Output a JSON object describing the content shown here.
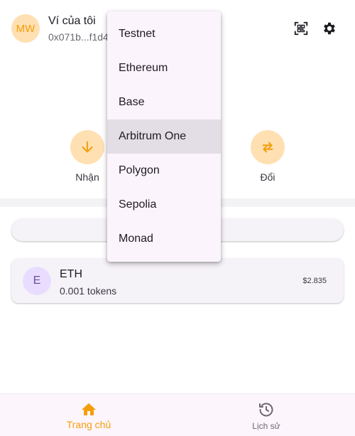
{
  "header": {
    "avatar_initials": "MW",
    "wallet_name": "Ví của tôi",
    "wallet_address": "0x071b...f1d4",
    "qr_icon": "qr-scan-icon",
    "settings_icon": "gear-icon"
  },
  "actions": {
    "receive_label": "Nhận",
    "swap_label": "Đổi",
    "receive_icon": "arrow-down-icon",
    "swap_icon": "swap-icon"
  },
  "tokens": [
    {
      "avatar": "E",
      "symbol": "ETH",
      "amount": "0.001 tokens",
      "value": "$2.835"
    }
  ],
  "network_menu": {
    "items": [
      "Testnet",
      "Ethereum",
      "Base",
      "Arbitrum One",
      "Polygon",
      "Sepolia",
      "Monad"
    ],
    "selected": "Arbitrum One"
  },
  "bottom_nav": {
    "items": [
      {
        "label": "Trang chủ",
        "icon": "home-icon",
        "active": true
      },
      {
        "label": "Lịch sử",
        "icon": "history-icon",
        "active": false
      }
    ]
  },
  "colors": {
    "accent": "#f59e0b",
    "accent_soft": "#ffe0b2",
    "menu_bg": "#fcf4fc",
    "menu_selected": "#e3dde5"
  }
}
